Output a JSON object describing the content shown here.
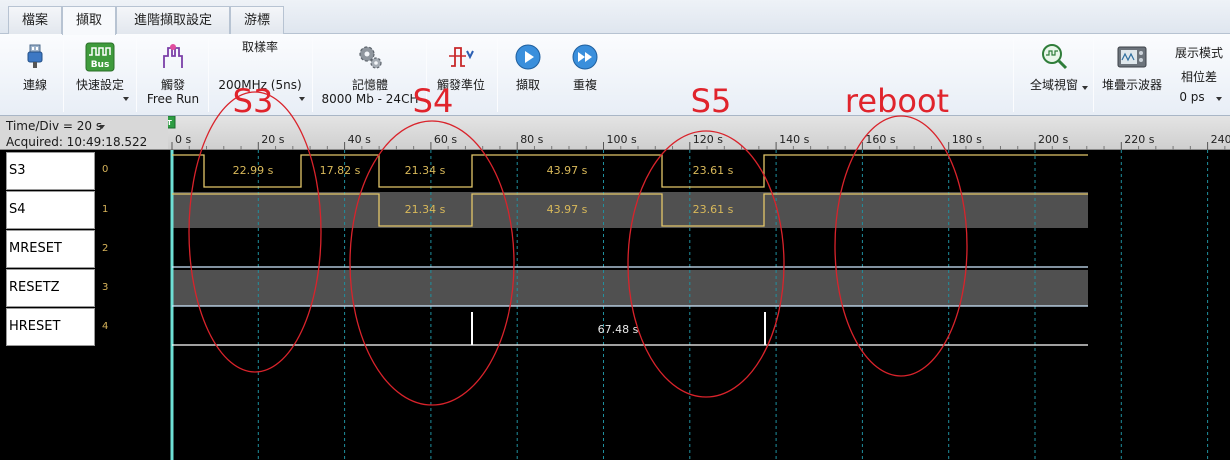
{
  "tabs": [
    {
      "label": "檔案"
    },
    {
      "label": "擷取"
    },
    {
      "label": "進階擷取設定"
    },
    {
      "label": "游標"
    }
  ],
  "ribbon": {
    "connect": "連線",
    "quick_setup": "快速設定",
    "trigger": "觸發",
    "trigger_mode": "Free Run",
    "sample_rate_title": "取樣率",
    "sample_rate_value": "200MHz (5ns)",
    "memory": "記憶體",
    "memory_value": "8000 Mb - 24CH",
    "trigger_level": "觸發準位",
    "capture": "擷取",
    "repeat": "重複",
    "global_view": "全域視窗",
    "stack_scope": "堆疊示波器",
    "display_mode": "展示模式",
    "phase_diff": "相位差",
    "phase_value": "0 ps"
  },
  "ruler": {
    "time_div": "Time/Div = 20 s",
    "acquired": "Acquired: 10:49:18.522",
    "ticks": [
      "0 s",
      "20 s",
      "40 s",
      "60 s",
      "80 s",
      "100 s",
      "120 s",
      "140 s",
      "160 s",
      "180 s",
      "200 s",
      "220 s",
      "240 s"
    ]
  },
  "channels": [
    {
      "name": "S3",
      "index": "0"
    },
    {
      "name": "S4",
      "index": "1"
    },
    {
      "name": "MRESET",
      "index": "2"
    },
    {
      "name": "RESETZ",
      "index": "3"
    },
    {
      "name": "HRESET",
      "index": "4"
    }
  ],
  "measurements": {
    "s3": [
      "22.99 s",
      "17.82 s",
      "21.34 s",
      "43.97 s",
      "23.61 s"
    ],
    "s4": [
      "21.34 s",
      "43.97 s",
      "23.61 s"
    ],
    "hreset": "67.48 s"
  },
  "annotations": [
    "S3",
    "S4",
    "S5",
    "reboot"
  ],
  "colors": {
    "s3_wave": "#e3c76a",
    "s4_wave": "#e3c76a",
    "reset_wave": "#cfe9ff",
    "hreset_wave": "#ffffff",
    "annotation_text": "#e0242c",
    "annotation_circle": "#d9232b",
    "grid": "#1f8f9e",
    "cursor": "#6fe0d6"
  },
  "icons": {
    "connect": "usb-icon",
    "quick_setup": "bus-icon",
    "trigger": "trigger-icon",
    "memory": "gears-icon",
    "trigger_level": "trigger-level-icon",
    "capture": "play-icon",
    "repeat": "fast-forward-icon",
    "global_view": "magnifier-icon",
    "stack_scope": "oscilloscope-icon"
  }
}
